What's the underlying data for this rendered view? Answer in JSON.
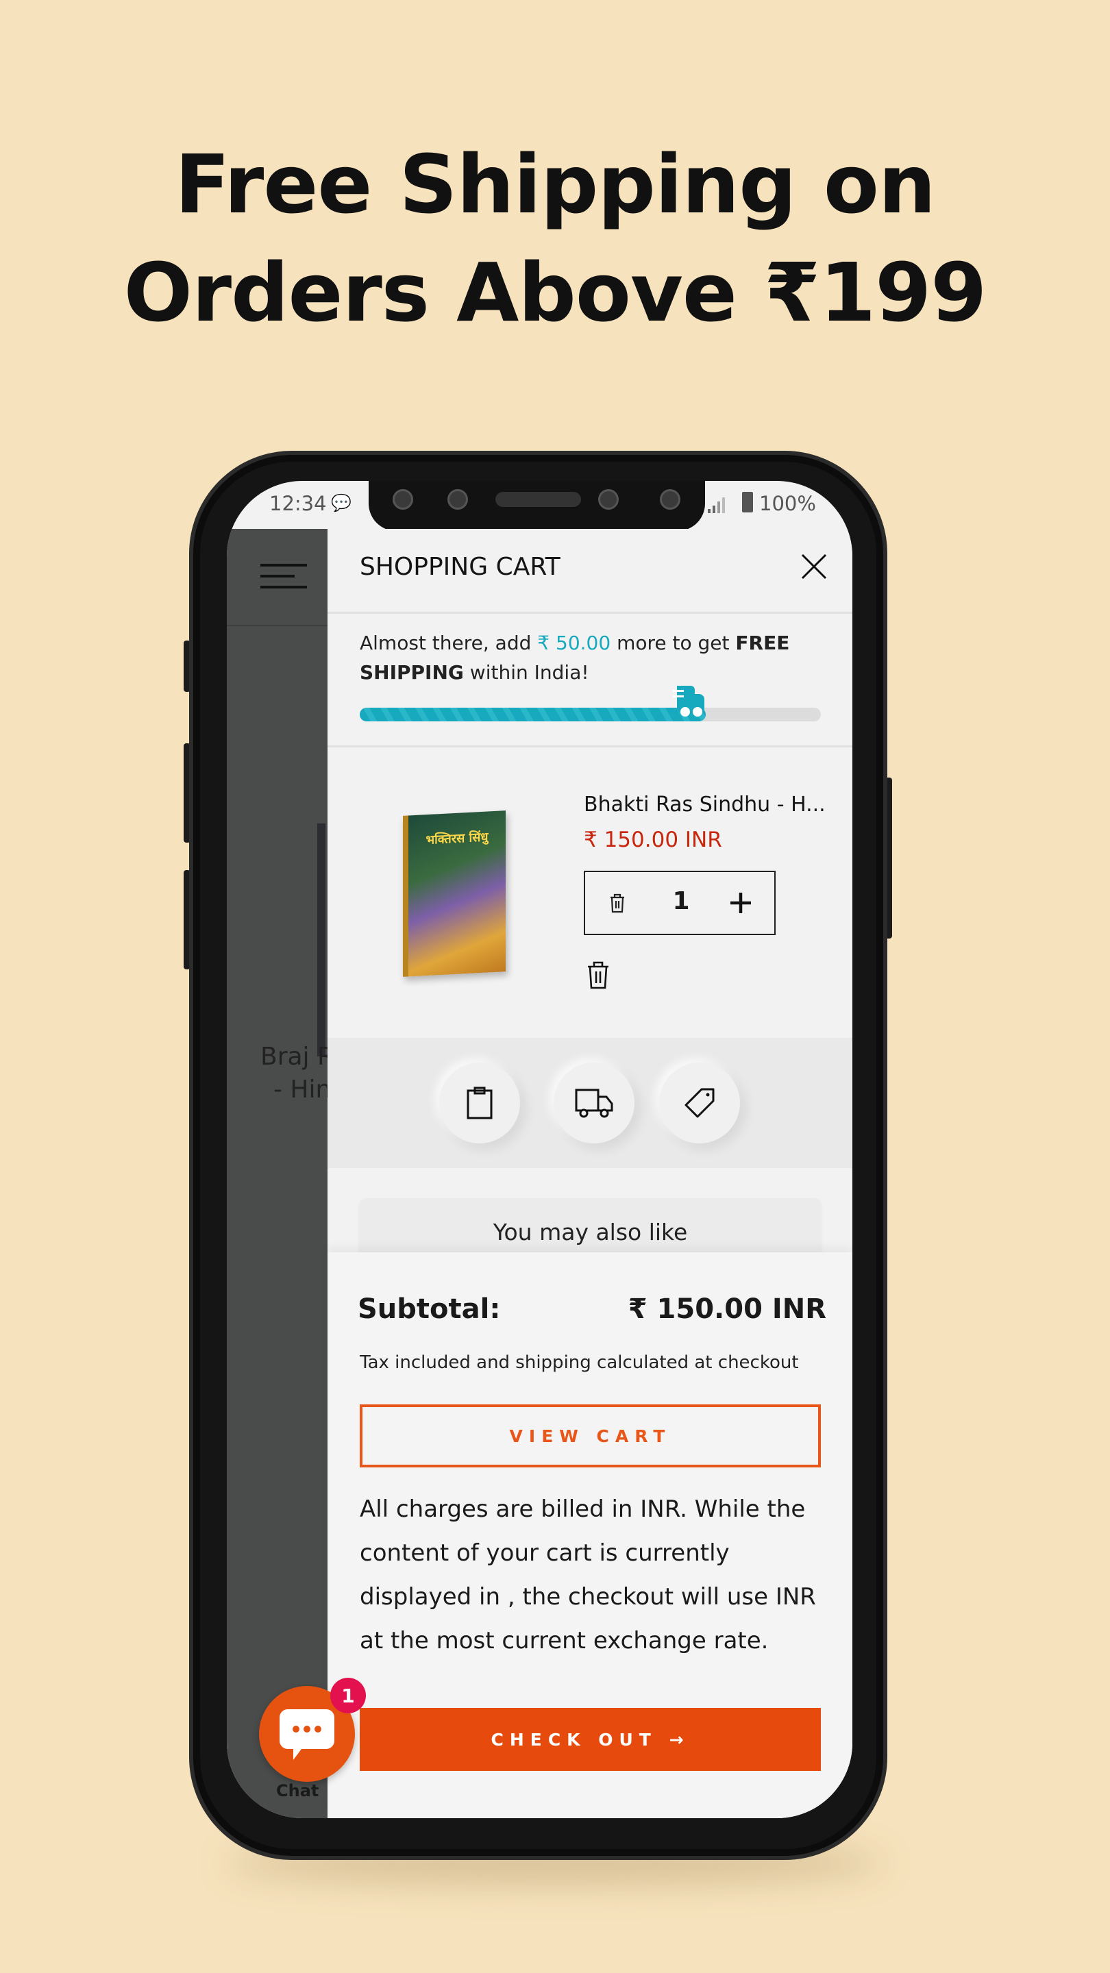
{
  "headline": {
    "line1": "Free Shipping on",
    "line2": "Orders Above ₹199"
  },
  "status_bar": {
    "time": "12:34",
    "battery": "100%"
  },
  "background_page": {
    "product_title_line1": "Braj R",
    "product_title_line2": "- Hin"
  },
  "cart": {
    "title": "SHOPPING CART",
    "shipping_msg": {
      "prefix": "Almost there, add ",
      "amount": "₹ 50.00",
      "middle": " more to get ",
      "bold1": "FREE",
      "bold2": "SHIPPING",
      "suffix": " within India!"
    },
    "progress_fraction": 0.75,
    "item": {
      "name": "Bhakti Ras Sindhu - H...",
      "price": "₹ 150.00 INR",
      "quantity": "1",
      "image_text": "भक्तिरस सिंधु"
    },
    "action_icons": [
      "clipboard-icon",
      "truck-icon",
      "tag-icon"
    ],
    "upsell_title": "You may also like",
    "subtotal_label": "Subtotal:",
    "subtotal_value": "₹ 150.00 INR",
    "tax_note": "Tax included and shipping calculated at checkout",
    "view_cart": "VIEW CART",
    "currency_note": "All charges are billed in INR. While the content of your cart is currently displayed in , the checkout will use INR at the most current exchange rate.",
    "checkout": "CHECK OUT →"
  },
  "chat": {
    "label": "Chat",
    "badge": "1"
  },
  "colors": {
    "accent": "#e64a0d",
    "teal": "#17a9bd",
    "price": "#c9260e",
    "badge": "#e3124f"
  }
}
